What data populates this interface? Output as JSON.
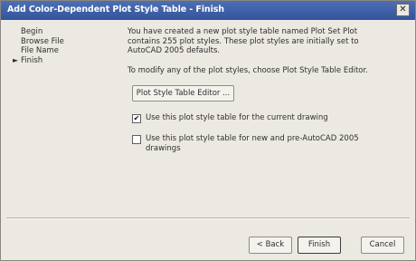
{
  "window": {
    "title": "Add Color-Dependent Plot Style Table - Finish",
    "close_icon": "close-icon"
  },
  "nav": {
    "items": [
      "Begin",
      "Browse File",
      "File Name",
      "Finish"
    ],
    "current_index": 3,
    "current_marker_icon": "arrow-right-icon"
  },
  "content": {
    "description_lines": [
      "You have created a new plot style table named Plot Set Plot",
      "contains 255 plot styles. These plot styles are initially set to",
      "AutoCAD 2005 defaults."
    ],
    "modify_text": "To modify any of the plot styles, choose Plot Style Table Editor.",
    "editor_button_label": "Plot Style Table Editor ...",
    "checkbox_current": {
      "label": "Use this plot style table for the current drawing",
      "checked": true
    },
    "checkbox_new": {
      "label_lines": [
        "Use this plot style table for new and pre-AutoCAD 2005",
        "drawings"
      ],
      "checked": false
    }
  },
  "footer": {
    "back_label": "< Back",
    "finish_label": "Finish",
    "cancel_label": "Cancel"
  }
}
